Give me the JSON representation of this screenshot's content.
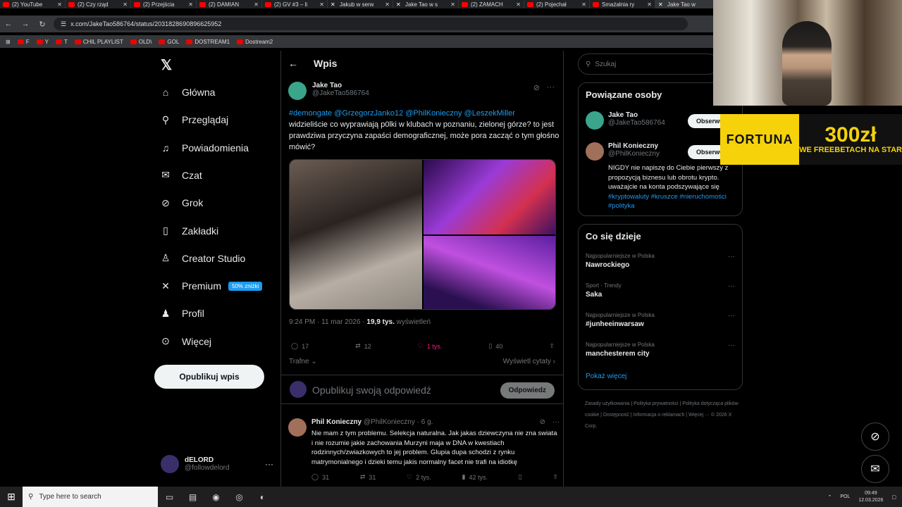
{
  "browser": {
    "tabs": [
      {
        "label": "(2) YouTube",
        "icon": "youtube-icon"
      },
      {
        "label": "(2) Czy rząd",
        "icon": "youtube-icon"
      },
      {
        "label": "(2) Przejścia",
        "icon": "youtube-icon"
      },
      {
        "label": "(2) DAMIAN",
        "icon": "youtube-icon"
      },
      {
        "label": "(2) GV #3 – li",
        "icon": "youtube-icon"
      },
      {
        "label": "Jakub w serw",
        "icon": "x-icon"
      },
      {
        "label": "Jake Tao w s",
        "icon": "x-icon"
      },
      {
        "label": "(2) ZAMACH",
        "icon": "youtube-icon"
      },
      {
        "label": "(2) Pojechał",
        "icon": "youtube-icon"
      },
      {
        "label": "Smażalnia ry",
        "icon": "youtube-icon"
      },
      {
        "label": "Jake Tao w",
        "icon": "x-icon"
      }
    ],
    "url": "x.com/JakeTao586764/status/2031828690896625952",
    "bookmarks": [
      "F",
      "Y",
      "T",
      "CHIL PLAYLIST",
      "OLD\\",
      "GOL",
      "DOSTREAM1",
      "Dostream2"
    ]
  },
  "sidebar": {
    "items": [
      {
        "label": "Główna",
        "icon": "home-icon",
        "glyph": "⌂"
      },
      {
        "label": "Przeglądaj",
        "icon": "search-icon",
        "glyph": "⚲"
      },
      {
        "label": "Powiadomienia",
        "icon": "bell-icon",
        "glyph": "♫"
      },
      {
        "label": "Czat",
        "icon": "mail-icon",
        "glyph": "✉"
      },
      {
        "label": "Grok",
        "icon": "grok-icon",
        "glyph": "⊘"
      },
      {
        "label": "Zakładki",
        "icon": "bookmark-icon",
        "glyph": "▯"
      },
      {
        "label": "Creator Studio",
        "icon": "creator-icon",
        "glyph": "♙"
      },
      {
        "label": "Premium",
        "icon": "x-icon",
        "glyph": "✕"
      },
      {
        "label": "Profil",
        "icon": "profile-icon",
        "glyph": "♟"
      },
      {
        "label": "Więcej",
        "icon": "more-icon",
        "glyph": "⊙"
      }
    ],
    "premium_badge": "50% zniżki",
    "post_button": "Opublikuj wpis",
    "account": {
      "name": "dELORD",
      "handle": "@followdelord"
    }
  },
  "main": {
    "header": "Wpis",
    "author": {
      "name": "Jake Tao",
      "handle": "@JakeTao586764"
    },
    "tweet_links": "#demongate @GrzegorzJanko12 @PhilKonieczny @LeszekMiller",
    "tweet_text": "widzieliście co wyprawiają p0lki w klubach w poznaniu, zielonej górze? to jest prawdziwa przyczyna zapaści demograficznej, może pora zacząć o tym głośno mówić?",
    "meta_time": "9:24 PM · 11 mar 2026 · ",
    "meta_views": "19,9 tys.",
    "meta_views_label": " wyświetleń",
    "actions": {
      "replies": "17",
      "reposts": "12",
      "likes": "1 tys.",
      "bookmarks": "40"
    },
    "sort": "Trafne",
    "quotes": "Wyświetl cytaty",
    "reply_placeholder": "Opublikuj swoją odpowiedź",
    "reply_button": "Odpowiedz",
    "comment": {
      "name": "Phil Konieczny",
      "handle_time": "@PhilKonieczny · 6 g.",
      "text": "Nie mam z tym problemu. Selekcja naturalna. Jak jakas dziewczyna nie zna swiata i nie rozumie jakie zachowania Murzyni maja w DNA w kwestiach rodzinnych/zwiazkowych to jej problem. Glupia dupa schodzi z rynku matrymonialnego i dzieki temu jakis normalny facet nie trafi na idiotkę",
      "replies": "31",
      "reposts": "31",
      "likes": "2 tys.",
      "views": "42 tys."
    }
  },
  "right": {
    "search_placeholder": "Szukaj",
    "related_title": "Powiązane osoby",
    "people": [
      {
        "name": "Jake Tao",
        "handle": "@JakeTao586764",
        "button": "Obserwuj"
      },
      {
        "name": "Phil Konieczny",
        "handle": "@PhilKonieczny",
        "button": "Obserwuj"
      }
    ],
    "bio_text": "NIGDY nie napiszę do Ciebie pierwszy z propozycją biznesu lub obrotu krypto. uważajcie na konta podszywające się ",
    "bio_tags": "#kryptowaluty #kruszce #nieruchomości #polityka",
    "trends_title": "Co się dzieje",
    "trends": [
      {
        "context": "Najpopularniejsze w Polska",
        "name": "Nawrockiego"
      },
      {
        "context": "Sport · Trendy",
        "name": "Saka"
      },
      {
        "context": "Najpopularniejsze w Polska",
        "name": "#junheeinwarsaw"
      },
      {
        "context": "Najpopularniejsze w Polska",
        "name": "manchesterem city"
      }
    ],
    "show_more": "Pokaż więcej",
    "footer": "Zasady użytkowania | Polityka prywatności | Polityka dotycząca plików cookie | Dostępność | Informacja o reklamach | Więcej ··· © 2026 X Corp."
  },
  "overlay": {
    "brand": "FORTUNA",
    "amount": "300zł",
    "promo": "WE FREEBETACH NA STAR"
  },
  "taskbar": {
    "search": "Type here to search",
    "lang": "POL",
    "time": "09:49",
    "date": "12.03.2026"
  },
  "colors": {
    "accent": "#1d9bf0",
    "like": "#f91880",
    "fortuna": "#f5d20a"
  }
}
